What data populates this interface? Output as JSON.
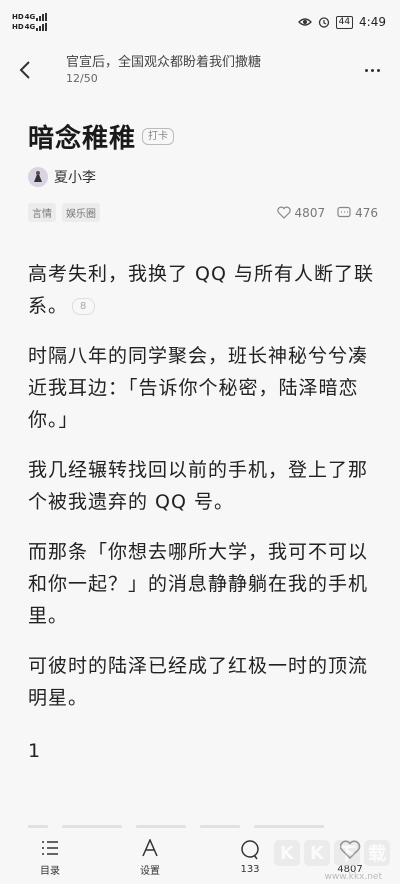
{
  "status": {
    "sim1": "HD",
    "sim2": "HD",
    "net1": "4G",
    "net2": "4G",
    "battery": "44",
    "time": "4:49"
  },
  "header": {
    "title": "官宣后，全国观众都盼着我们撒糖",
    "progress": "12/50"
  },
  "book": {
    "title": "暗念稚稚",
    "checkin": "打卡",
    "author": "夏小李",
    "tags": [
      "言情",
      "娱乐圈"
    ],
    "likes": "4807",
    "comments": "476"
  },
  "paragraphs": [
    {
      "text": "高考失利，我换了 QQ 与所有人断了联系。",
      "comment_count": "8"
    },
    {
      "text": "时隔八年的同学聚会，班长神秘兮兮凑近我耳边：「告诉你个秘密，陆泽暗恋你。」"
    },
    {
      "text": "我几经辗转找回以前的手机，登上了那个被我遗弃的 QQ 号。"
    },
    {
      "text": "而那条「你想去哪所大学，我可不可以和你一起？」的消息静静躺在我的手机里。"
    },
    {
      "text": "可彼时的陆泽已经成了红极一时的顶流明星。"
    }
  ],
  "chapter_number": "1",
  "bottom_nav": {
    "catalog": "目录",
    "settings": "设置",
    "comments": "133",
    "likes": "4807"
  },
  "watermark": {
    "letters": [
      "K",
      "K",
      "下",
      "载"
    ],
    "site": "www.kkx.net"
  }
}
